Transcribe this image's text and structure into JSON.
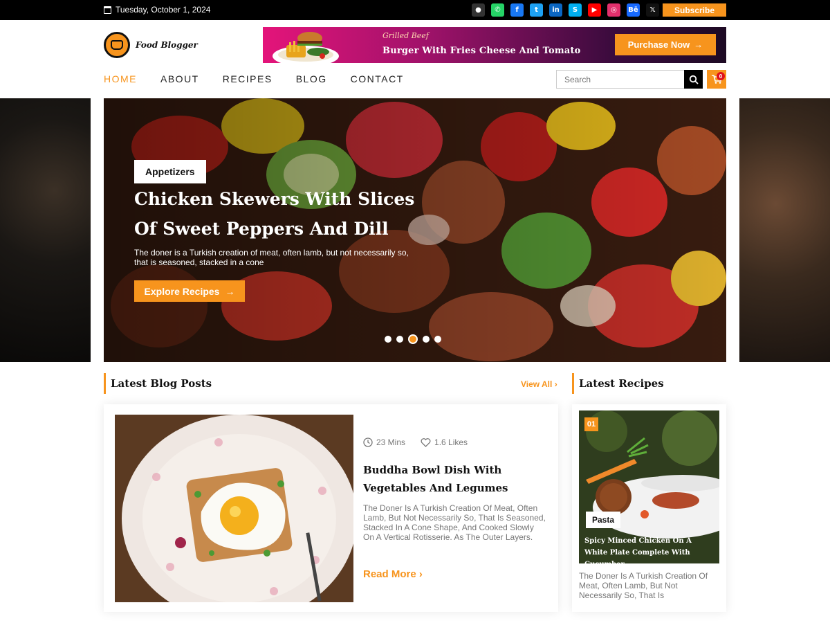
{
  "topbar": {
    "date": "Tuesday, October 1, 2024",
    "subscribe_label": "Subscribe",
    "social": [
      {
        "icon": "github-icon",
        "glyph": "●",
        "color": "#333333"
      },
      {
        "icon": "whatsapp-icon",
        "glyph": "✆",
        "color": "#25d366"
      },
      {
        "icon": "facebook-icon",
        "glyph": "f",
        "color": "#1877f2"
      },
      {
        "icon": "twitter-icon",
        "glyph": "t",
        "color": "#1da1f2"
      },
      {
        "icon": "linkedin-icon",
        "glyph": "in",
        "color": "#0a66c2"
      },
      {
        "icon": "skype-icon",
        "glyph": "S",
        "color": "#00aff0"
      },
      {
        "icon": "youtube-icon",
        "glyph": "▶",
        "color": "#ff0000"
      },
      {
        "icon": "instagram-icon",
        "glyph": "◎",
        "color": "#e1306c"
      },
      {
        "icon": "behance-icon",
        "glyph": "Bē",
        "color": "#1769ff"
      },
      {
        "icon": "x-icon",
        "glyph": "𝕏",
        "color": "#111111"
      }
    ]
  },
  "header": {
    "logo_text": "Food Blogger",
    "banner": {
      "subtitle": "Grilled Beef",
      "title": "Burger With Fries Cheese And Tomato",
      "button_label": "Purchase Now"
    }
  },
  "nav": {
    "items": [
      "HOME",
      "ABOUT",
      "RECIPES",
      "BLOG",
      "CONTACT"
    ],
    "search_placeholder": "Search",
    "cart_count": "0"
  },
  "hero": {
    "tag": "Appetizers",
    "title": "Chicken Skewers With Slices Of Sweet Peppers And Dill",
    "description": "The doner is a Turkish creation of meat, often lamb, but not necessarily so, that is seasoned, stacked in a cone",
    "button_label": "Explore Recipes",
    "slide_count": 5,
    "active_slide": 3
  },
  "blog": {
    "heading": "Latest Blog Posts",
    "view_all": "View All",
    "post": {
      "time": "23 Mins",
      "likes": "1.6 Likes",
      "title": "Buddha Bowl Dish With Vegetables And Legumes",
      "text": "The Doner Is A Turkish Creation Of Meat, Often Lamb, But Not Necessarily So, That Is Seasoned, Stacked In A Cone Shape, And Cooked Slowly On A Vertical Rotisserie. As The Outer Layers.",
      "read_more": "Read More"
    }
  },
  "recipes": {
    "heading": "Latest Recipes",
    "item": {
      "number": "01",
      "category": "Pasta",
      "title": "Spicy Minced Chicken On A White Plate Complete With Cucumber",
      "text": "The Doner Is A Turkish Creation Of Meat, Often Lamb, But Not Necessarily So, That Is"
    }
  },
  "colors": {
    "accent": "#f7941d",
    "topbar": "#000000"
  }
}
